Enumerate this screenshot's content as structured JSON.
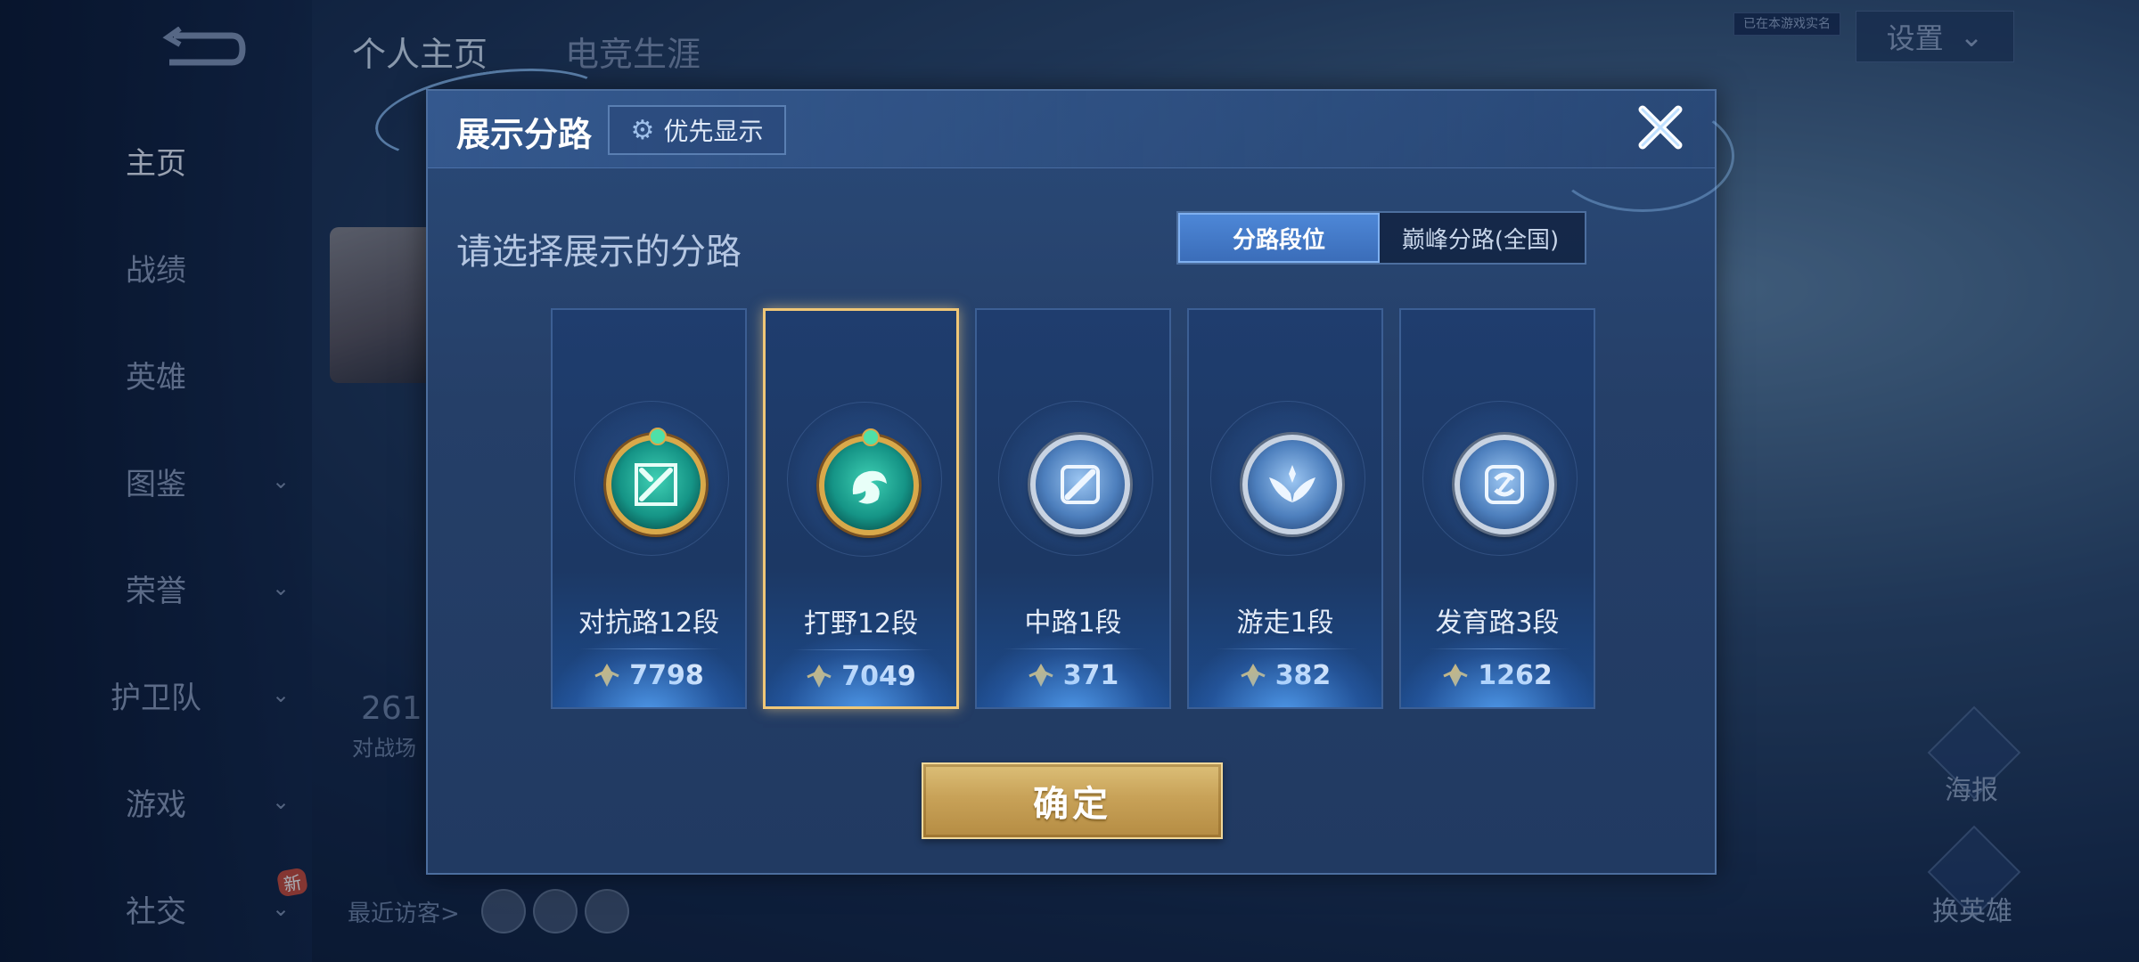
{
  "background": {
    "top_tabs": [
      "个人主页",
      "电竞生涯"
    ],
    "settings_label": "设置",
    "small_tag": "已在本游戏实名",
    "sidebar": [
      {
        "label": "主页",
        "active": true,
        "has_chevron": false
      },
      {
        "label": "战绩",
        "active": false,
        "has_chevron": false
      },
      {
        "label": "英雄",
        "active": false,
        "has_chevron": false
      },
      {
        "label": "图鉴",
        "active": false,
        "has_chevron": true
      },
      {
        "label": "荣誉",
        "active": false,
        "has_chevron": true
      },
      {
        "label": "护卫队",
        "active": false,
        "has_chevron": true
      },
      {
        "label": "游戏",
        "active": false,
        "has_chevron": true
      },
      {
        "label": "社交",
        "active": false,
        "has_chevron": true
      }
    ],
    "new_badge": "新",
    "stat_value": "261",
    "stat_label": "对战场",
    "recent_visitors": "最近访客>",
    "poster_label": "海报",
    "change_hero_label": "换英雄"
  },
  "dialog": {
    "title": "展示分路",
    "priority_label": "优先显示",
    "subtitle": "请选择展示的分路",
    "toggle": [
      "分路段位",
      "巅峰分路(全国)"
    ],
    "toggle_active_index": 0,
    "confirm_label": "确定",
    "lanes": [
      {
        "rank": "对抗路12段",
        "score": "7798",
        "emblem": "clash-lane-emblem",
        "tier": "gold",
        "selected": false
      },
      {
        "rank": "打野12段",
        "score": "7049",
        "emblem": "jungle-emblem",
        "tier": "gold",
        "selected": true
      },
      {
        "rank": "中路1段",
        "score": "371",
        "emblem": "mid-lane-emblem",
        "tier": "silver",
        "selected": false
      },
      {
        "rank": "游走1段",
        "score": "382",
        "emblem": "roam-emblem",
        "tier": "silver",
        "selected": false
      },
      {
        "rank": "发育路3段",
        "score": "1262",
        "emblem": "farm-lane-emblem",
        "tier": "silver",
        "selected": false
      }
    ]
  }
}
